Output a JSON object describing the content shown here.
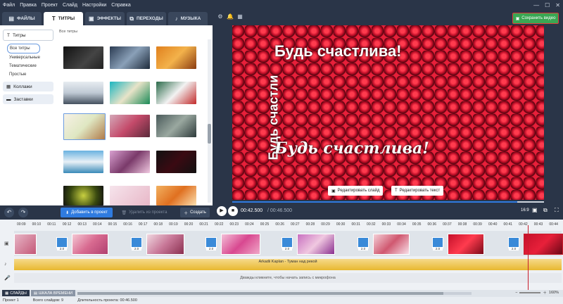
{
  "menu": [
    "Файл",
    "Правка",
    "Проект",
    "Слайд",
    "Настройки",
    "Справка"
  ],
  "tabs": [
    {
      "label": "ФАЙЛЫ",
      "icon": "folder-icon"
    },
    {
      "label": "ТИТРЫ",
      "icon": "text-icon"
    },
    {
      "label": "ЭФФЕКТЫ",
      "icon": "effects-icon"
    },
    {
      "label": "ПЕРЕХОДЫ",
      "icon": "transitions-icon"
    },
    {
      "label": "МУЗЫКА",
      "icon": "music-icon"
    }
  ],
  "save_button": "Сохранить видео",
  "left": {
    "categories": {
      "titles": "Титры",
      "collages": "Коллажи",
      "intros": "Заставки"
    },
    "subcats": [
      "Все титры",
      "Универсальные",
      "Тематические",
      "Простые"
    ],
    "grid_label": "Все титры"
  },
  "left_bottom": {
    "add": "Добавить в проект",
    "delete": "Удалить из проекта",
    "create": "Создать"
  },
  "preview": {
    "vertical_title": "Будь счастли",
    "title": "Будь счастлива!",
    "script_title": "Будь счастлива!",
    "edit_slide": "Редактировать слайд",
    "edit_text": "Редактировать текст",
    "progress": 0.915
  },
  "playbar": {
    "time": "00:42.500",
    "total": "/ 00:46.500",
    "ratio": "16:9"
  },
  "timeline": {
    "ticks": [
      "00:09",
      "00:10",
      "00:11",
      "00:12",
      "00:13",
      "00:14",
      "00:15",
      "00:16",
      "00:17",
      "00:18",
      "00:19",
      "00:20",
      "00:21",
      "00:22",
      "00:23",
      "00:24",
      "00:25",
      "00:26",
      "00:27",
      "00:28",
      "00:29",
      "00:30",
      "00:31",
      "00:32",
      "00:33",
      "00:34",
      "00:35",
      "00:36",
      "00:37",
      "00:38",
      "00:39",
      "00:40",
      "00:41",
      "00:42",
      "00:43",
      "00:44"
    ],
    "transition_duration": "2.0",
    "audio_label": "Arkadii Kaplan - Туман над рекой",
    "mic_label": "Дважды кликните, чтобы начать запись с микрофона"
  },
  "footer": {
    "slides": "СЛАЙДЫ",
    "scale": "ШКАЛА ВРЕМЕНИ",
    "zoom": "160%"
  },
  "status": {
    "project": "Проект 1",
    "slides": "Всего слайдов: 9",
    "duration": "Длительность проекта: 00:46.500"
  }
}
